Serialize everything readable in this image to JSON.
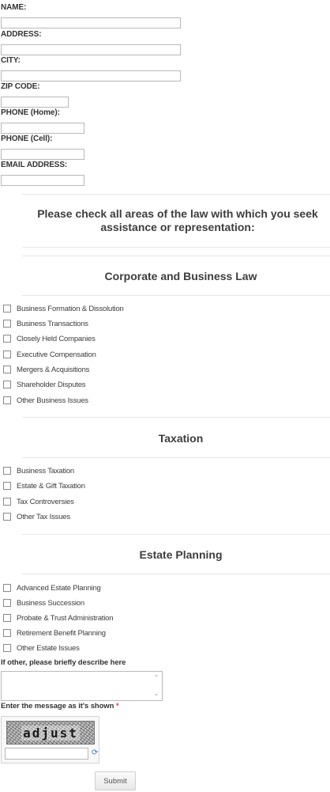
{
  "contact_fields": [
    {
      "label": "NAME:",
      "value": ""
    },
    {
      "label": "ADDRESS:",
      "value": ""
    },
    {
      "label": "CITY:",
      "value": ""
    },
    {
      "label": "ZIP CODE:",
      "value": ""
    },
    {
      "label": "PHONE (Home):",
      "value": ""
    },
    {
      "label": "PHONE (Cell):",
      "value": ""
    },
    {
      "label": "EMAIL ADDRESS:",
      "value": ""
    }
  ],
  "intro": "Please check all areas of the law with which you seek assistance or representation:",
  "sections": [
    {
      "title": "Corporate and Business Law",
      "options": [
        "Business Formation & Dissolution",
        "Business Transactions",
        "Closely Held Companies",
        "Executive Compensation",
        "Mergers & Acquisitions",
        "Shareholder Disputes",
        "Other Business Issues"
      ]
    },
    {
      "title": "Taxation",
      "options": [
        "Business Taxation",
        "Estate & Gift Taxation",
        "Tax Controversies",
        "Other Tax Issues"
      ]
    },
    {
      "title": "Estate Planning",
      "options": [
        "Advanced Estate Planning",
        "Business Succession",
        "Probate & Trust Administration",
        "Retirement Benefit Planning",
        "Other Estate Issues"
      ]
    }
  ],
  "other_label": "If other, please briefly describe here",
  "other_value": "",
  "captcha": {
    "label": "Enter the message as it's shown",
    "required_mark": "*",
    "image_text": "adjust",
    "value": ""
  },
  "submit_label": "Submit",
  "colors": {
    "required": "#e04040",
    "refresh_icon": "#3a7bd5"
  }
}
